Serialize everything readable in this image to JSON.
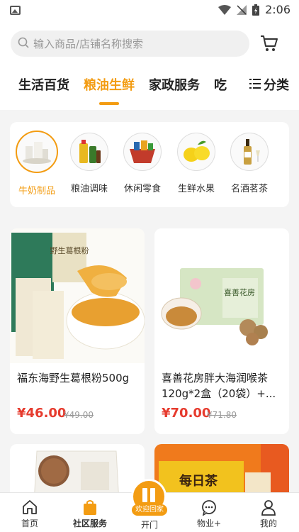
{
  "status_bar": {
    "time": "2:06"
  },
  "search": {
    "placeholder": "输入商品/店铺名称搜索"
  },
  "tabs": [
    {
      "label": "生活百货"
    },
    {
      "label": "粮油生鲜",
      "active": true
    },
    {
      "label": "家政服务"
    },
    {
      "label": "吃"
    }
  ],
  "category_button": {
    "label": "分类"
  },
  "categories": [
    {
      "label": "牛奶制品",
      "active": true
    },
    {
      "label": "粮油调味"
    },
    {
      "label": "休闲零食"
    },
    {
      "label": "生鲜水果"
    },
    {
      "label": "名酒茗茶"
    }
  ],
  "products": [
    {
      "name": "福东海野生葛根粉500g",
      "price": "¥46.00",
      "original_price": "¥49.00",
      "pack_text": "野生葛根粉"
    },
    {
      "name": "喜善花房胖大海润喉茶120g*2盒（20袋）+...",
      "price": "¥70.00",
      "original_price": "¥71.80",
      "pack_text": "喜善花房"
    },
    {
      "name": "",
      "price": "",
      "original_price": ""
    },
    {
      "name": "",
      "price": "",
      "original_price": "",
      "pack_text": "每日茶"
    }
  ],
  "bottom_nav": [
    {
      "label": "首页",
      "icon": "home-icon"
    },
    {
      "label": "社区服务",
      "icon": "bag-icon",
      "active": true
    },
    {
      "label": "开门",
      "icon": "door-icon",
      "badge": "欢迎回家"
    },
    {
      "label": "物业+",
      "icon": "chat-icon"
    },
    {
      "label": "我的",
      "icon": "user-icon"
    }
  ],
  "colors": {
    "accent": "#f39c12",
    "price": "#e63b2e"
  }
}
